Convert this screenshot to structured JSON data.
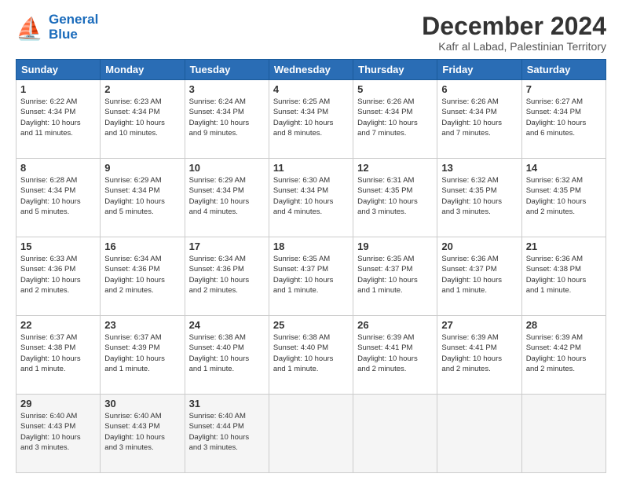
{
  "header": {
    "logo_line1": "General",
    "logo_line2": "Blue",
    "month": "December 2024",
    "location": "Kafr al Labad, Palestinian Territory"
  },
  "weekdays": [
    "Sunday",
    "Monday",
    "Tuesday",
    "Wednesday",
    "Thursday",
    "Friday",
    "Saturday"
  ],
  "weeks": [
    [
      {
        "day": "1",
        "lines": [
          "Sunrise: 6:22 AM",
          "Sunset: 4:34 PM",
          "Daylight: 10 hours",
          "and 11 minutes."
        ]
      },
      {
        "day": "2",
        "lines": [
          "Sunrise: 6:23 AM",
          "Sunset: 4:34 PM",
          "Daylight: 10 hours",
          "and 10 minutes."
        ]
      },
      {
        "day": "3",
        "lines": [
          "Sunrise: 6:24 AM",
          "Sunset: 4:34 PM",
          "Daylight: 10 hours",
          "and 9 minutes."
        ]
      },
      {
        "day": "4",
        "lines": [
          "Sunrise: 6:25 AM",
          "Sunset: 4:34 PM",
          "Daylight: 10 hours",
          "and 8 minutes."
        ]
      },
      {
        "day": "5",
        "lines": [
          "Sunrise: 6:26 AM",
          "Sunset: 4:34 PM",
          "Daylight: 10 hours",
          "and 7 minutes."
        ]
      },
      {
        "day": "6",
        "lines": [
          "Sunrise: 6:26 AM",
          "Sunset: 4:34 PM",
          "Daylight: 10 hours",
          "and 7 minutes."
        ]
      },
      {
        "day": "7",
        "lines": [
          "Sunrise: 6:27 AM",
          "Sunset: 4:34 PM",
          "Daylight: 10 hours",
          "and 6 minutes."
        ]
      }
    ],
    [
      {
        "day": "8",
        "lines": [
          "Sunrise: 6:28 AM",
          "Sunset: 4:34 PM",
          "Daylight: 10 hours",
          "and 5 minutes."
        ]
      },
      {
        "day": "9",
        "lines": [
          "Sunrise: 6:29 AM",
          "Sunset: 4:34 PM",
          "Daylight: 10 hours",
          "and 5 minutes."
        ]
      },
      {
        "day": "10",
        "lines": [
          "Sunrise: 6:29 AM",
          "Sunset: 4:34 PM",
          "Daylight: 10 hours",
          "and 4 minutes."
        ]
      },
      {
        "day": "11",
        "lines": [
          "Sunrise: 6:30 AM",
          "Sunset: 4:34 PM",
          "Daylight: 10 hours",
          "and 4 minutes."
        ]
      },
      {
        "day": "12",
        "lines": [
          "Sunrise: 6:31 AM",
          "Sunset: 4:35 PM",
          "Daylight: 10 hours",
          "and 3 minutes."
        ]
      },
      {
        "day": "13",
        "lines": [
          "Sunrise: 6:32 AM",
          "Sunset: 4:35 PM",
          "Daylight: 10 hours",
          "and 3 minutes."
        ]
      },
      {
        "day": "14",
        "lines": [
          "Sunrise: 6:32 AM",
          "Sunset: 4:35 PM",
          "Daylight: 10 hours",
          "and 2 minutes."
        ]
      }
    ],
    [
      {
        "day": "15",
        "lines": [
          "Sunrise: 6:33 AM",
          "Sunset: 4:36 PM",
          "Daylight: 10 hours",
          "and 2 minutes."
        ]
      },
      {
        "day": "16",
        "lines": [
          "Sunrise: 6:34 AM",
          "Sunset: 4:36 PM",
          "Daylight: 10 hours",
          "and 2 minutes."
        ]
      },
      {
        "day": "17",
        "lines": [
          "Sunrise: 6:34 AM",
          "Sunset: 4:36 PM",
          "Daylight: 10 hours",
          "and 2 minutes."
        ]
      },
      {
        "day": "18",
        "lines": [
          "Sunrise: 6:35 AM",
          "Sunset: 4:37 PM",
          "Daylight: 10 hours",
          "and 1 minute."
        ]
      },
      {
        "day": "19",
        "lines": [
          "Sunrise: 6:35 AM",
          "Sunset: 4:37 PM",
          "Daylight: 10 hours",
          "and 1 minute."
        ]
      },
      {
        "day": "20",
        "lines": [
          "Sunrise: 6:36 AM",
          "Sunset: 4:37 PM",
          "Daylight: 10 hours",
          "and 1 minute."
        ]
      },
      {
        "day": "21",
        "lines": [
          "Sunrise: 6:36 AM",
          "Sunset: 4:38 PM",
          "Daylight: 10 hours",
          "and 1 minute."
        ]
      }
    ],
    [
      {
        "day": "22",
        "lines": [
          "Sunrise: 6:37 AM",
          "Sunset: 4:38 PM",
          "Daylight: 10 hours",
          "and 1 minute."
        ]
      },
      {
        "day": "23",
        "lines": [
          "Sunrise: 6:37 AM",
          "Sunset: 4:39 PM",
          "Daylight: 10 hours",
          "and 1 minute."
        ]
      },
      {
        "day": "24",
        "lines": [
          "Sunrise: 6:38 AM",
          "Sunset: 4:40 PM",
          "Daylight: 10 hours",
          "and 1 minute."
        ]
      },
      {
        "day": "25",
        "lines": [
          "Sunrise: 6:38 AM",
          "Sunset: 4:40 PM",
          "Daylight: 10 hours",
          "and 1 minute."
        ]
      },
      {
        "day": "26",
        "lines": [
          "Sunrise: 6:39 AM",
          "Sunset: 4:41 PM",
          "Daylight: 10 hours",
          "and 2 minutes."
        ]
      },
      {
        "day": "27",
        "lines": [
          "Sunrise: 6:39 AM",
          "Sunset: 4:41 PM",
          "Daylight: 10 hours",
          "and 2 minutes."
        ]
      },
      {
        "day": "28",
        "lines": [
          "Sunrise: 6:39 AM",
          "Sunset: 4:42 PM",
          "Daylight: 10 hours",
          "and 2 minutes."
        ]
      }
    ],
    [
      {
        "day": "29",
        "lines": [
          "Sunrise: 6:40 AM",
          "Sunset: 4:43 PM",
          "Daylight: 10 hours",
          "and 3 minutes."
        ]
      },
      {
        "day": "30",
        "lines": [
          "Sunrise: 6:40 AM",
          "Sunset: 4:43 PM",
          "Daylight: 10 hours",
          "and 3 minutes."
        ]
      },
      {
        "day": "31",
        "lines": [
          "Sunrise: 6:40 AM",
          "Sunset: 4:44 PM",
          "Daylight: 10 hours",
          "and 3 minutes."
        ]
      },
      null,
      null,
      null,
      null
    ]
  ]
}
